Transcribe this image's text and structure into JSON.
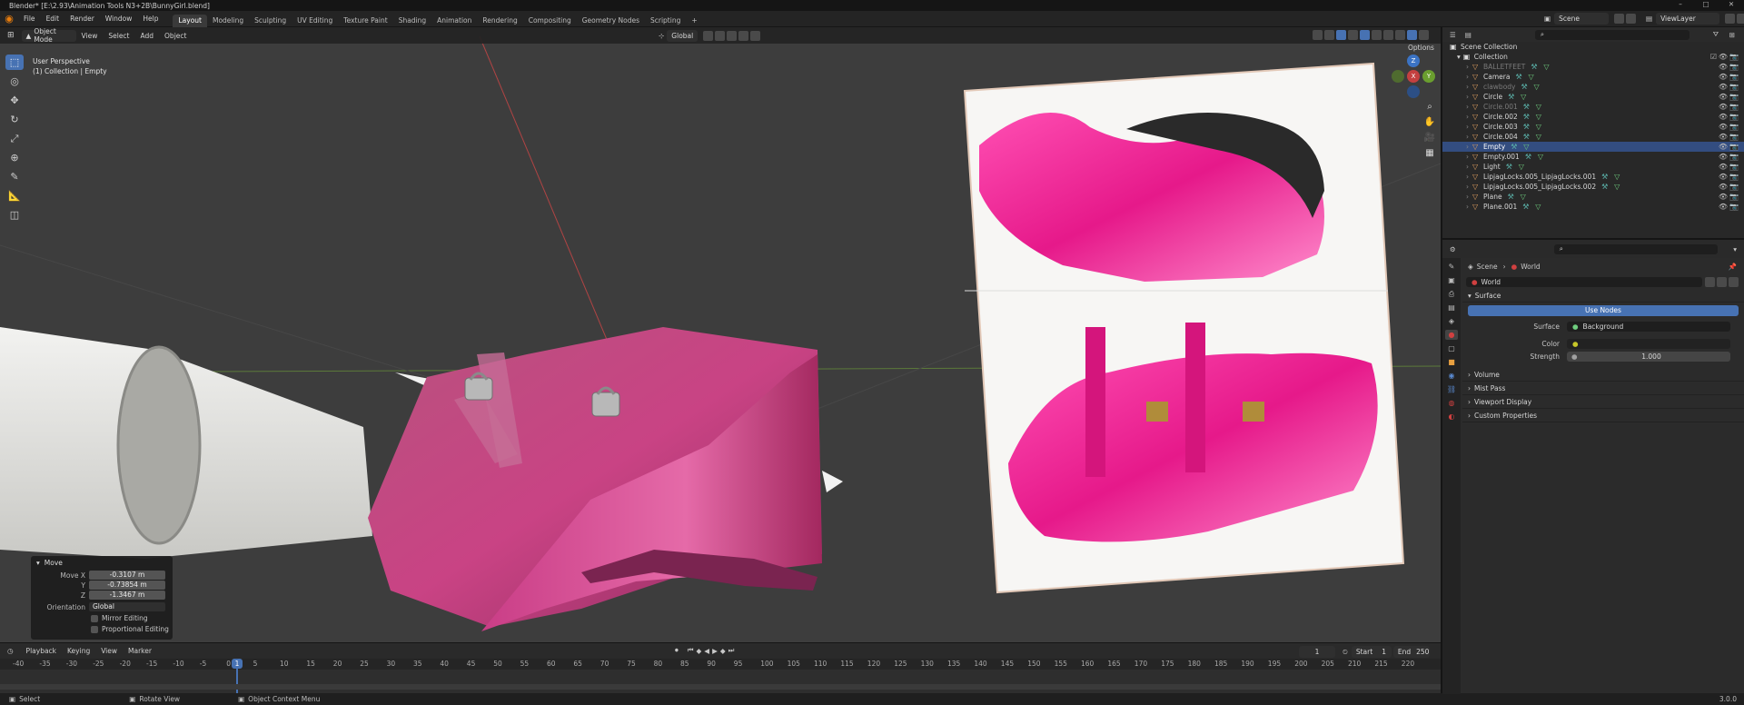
{
  "window": {
    "title": "Blender* [E:\\2.93\\Animation Tools N3+2B\\BunnyGirl.blend]",
    "controls": [
      "–",
      "□",
      "✕"
    ]
  },
  "menu": {
    "items": [
      "File",
      "Edit",
      "Render",
      "Window",
      "Help"
    ]
  },
  "workspaces": {
    "tabs": [
      "Layout",
      "Modeling",
      "Sculpting",
      "UV Editing",
      "Texture Paint",
      "Shading",
      "Animation",
      "Rendering",
      "Compositing",
      "Geometry Nodes",
      "Scripting"
    ],
    "add": "+"
  },
  "scene": {
    "name": "Scene",
    "view_layer": "ViewLayer"
  },
  "viewport": {
    "mode": "Object Mode",
    "menus": [
      "View",
      "Select",
      "Add",
      "Object"
    ],
    "transform_orientation": "Global",
    "options_label": "Options",
    "perspective_label": "User Perspective",
    "context_label": "(1) Collection | Empty",
    "gizmo_axes": {
      "x": "X",
      "y": "Y",
      "z": "Z"
    }
  },
  "operator_panel": {
    "title": "Move",
    "move_x_label": "Move X",
    "move_x": "-0.3107 m",
    "y_label": "Y",
    "y": "-0.73854 m",
    "z_label": "Z",
    "z": "-1.3467 m",
    "orientation_label": "Orientation",
    "orientation": "Global",
    "mirror_editing": "Mirror Editing",
    "proportional_editing": "Proportional Editing"
  },
  "timeline": {
    "menus": [
      "Playback",
      "Keying",
      "View",
      "Marker"
    ],
    "current_frame": "1",
    "start_label": "Start",
    "start": "1",
    "end_label": "End",
    "end": "250",
    "ticks": [
      "-40",
      "-35",
      "-30",
      "-25",
      "-20",
      "-15",
      "-10",
      "-5",
      "0",
      "5",
      "10",
      "15",
      "20",
      "25",
      "30",
      "35",
      "40",
      "45",
      "50",
      "55",
      "60",
      "65",
      "70",
      "75",
      "80",
      "85",
      "90",
      "95",
      "100",
      "105",
      "110",
      "115",
      "120",
      "125",
      "130",
      "135",
      "140",
      "145",
      "150",
      "155",
      "160",
      "165",
      "170",
      "175",
      "180",
      "185",
      "190",
      "195",
      "200",
      "205",
      "210",
      "215",
      "220"
    ]
  },
  "status_bar": {
    "select": "Select",
    "rotate": "Rotate View",
    "context_menu": "Object Context Menu",
    "version": "3.0.0"
  },
  "outliner": {
    "root": "Scene Collection",
    "collection": "Collection",
    "items": [
      {
        "name": "BALLETFEET",
        "dim": true
      },
      {
        "name": "Camera",
        "dim": false
      },
      {
        "name": "clawbody",
        "dim": true
      },
      {
        "name": "Circle",
        "dim": false
      },
      {
        "name": "Circle.001",
        "dim": true
      },
      {
        "name": "Circle.002",
        "dim": false
      },
      {
        "name": "Circle.003",
        "dim": false
      },
      {
        "name": "Circle.004",
        "dim": false
      },
      {
        "name": "Empty",
        "dim": false,
        "selected": true
      },
      {
        "name": "Empty.001",
        "dim": false
      },
      {
        "name": "Light",
        "dim": false
      },
      {
        "name": "LipjagLocks.005_LipjagLocks.001",
        "dim": false
      },
      {
        "name": "LipjagLocks.005_LipjagLocks.002",
        "dim": false
      },
      {
        "name": "Plane",
        "dim": false
      },
      {
        "name": "Plane.001",
        "dim": false
      }
    ]
  },
  "properties": {
    "breadcrumb": {
      "scene": "Scene",
      "world": "World"
    },
    "datablock": "World",
    "surface_section": "Surface",
    "use_nodes": "Use Nodes",
    "surface_label": "Surface",
    "surface_value": "Background",
    "color_label": "Color",
    "strength_label": "Strength",
    "strength_value": "1.000",
    "collapsed_sections": [
      "Volume",
      "Mist Pass",
      "Viewport Display",
      "Custom Properties"
    ]
  },
  "colors": {
    "accent": "#4772b3",
    "selection": "#334d80",
    "shoe_pink": "#d43c8c",
    "viewport_bg": "#3d3d3d"
  }
}
